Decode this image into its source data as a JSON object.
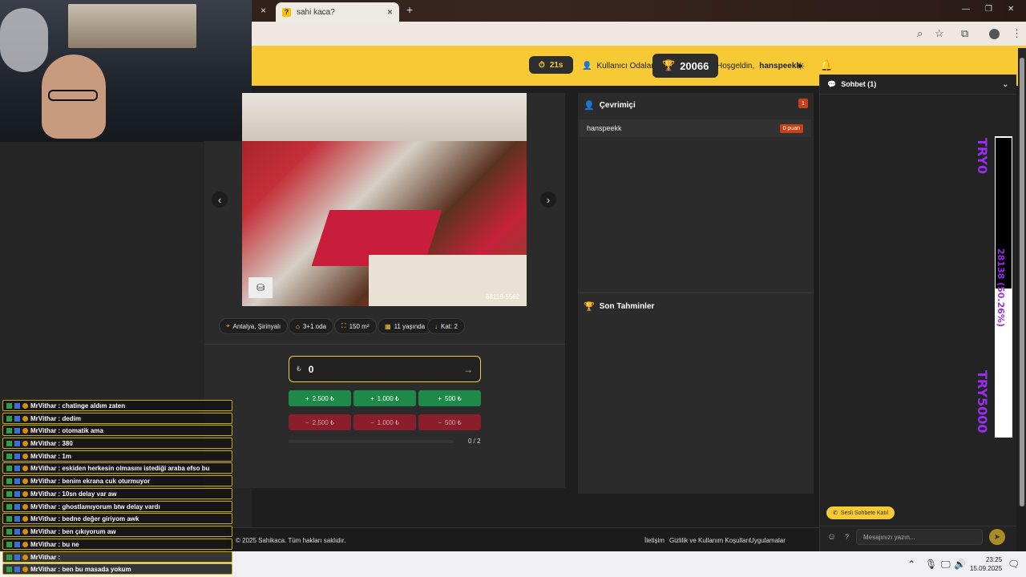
{
  "browser": {
    "tab_title": "sahi kaca?",
    "tab_favicon": "?",
    "tab_close": "×",
    "new_tab": "+",
    "prev_tab_close": "×",
    "window_min": "—",
    "window_max": "❐",
    "window_close": "✕"
  },
  "header": {
    "timer": "21s",
    "rooms_label": "Kullanıcı Odaları",
    "score": "20066",
    "welcome_prefix": "Hoşgeldin,",
    "username": "hanspeekk"
  },
  "game": {
    "photo_code": "68118-5562",
    "tags": [
      {
        "icon": "location-icon",
        "label": "Antalya, Şirinyalı"
      },
      {
        "icon": "home-icon",
        "label": "3+1 oda"
      },
      {
        "icon": "area-icon",
        "label": "150 m²"
      },
      {
        "icon": "building-icon",
        "label": "11 yaşında"
      },
      {
        "icon": "floor-icon",
        "label": "Kat: 2"
      }
    ],
    "guess_currency": "₺",
    "guess_value": "0",
    "plus_buttons": [
      "2.500 ₺",
      "1.000 ₺",
      "500 ₺"
    ],
    "minus_buttons": [
      "2.500 ₺",
      "1.000 ₺",
      "500 ₺"
    ],
    "progress_text": "0 / 2",
    "progress_fraction": 0
  },
  "online": {
    "title": "Çevrimiçi",
    "count": "1",
    "users": [
      {
        "name": "hanspeekk",
        "points": "0 puan"
      }
    ]
  },
  "recent": {
    "title": "Son Tahminler"
  },
  "chat": {
    "title": "Sohbet (1)",
    "voice_button": "Sesli Sohbete Katıl",
    "input_placeholder": "Mesajınızı yazın...",
    "help": "?"
  },
  "footer": {
    "copyright": "© 2025 Sahikaca. Tüm hakları saklıdır.",
    "links": [
      "İletişim",
      "Gizlilik ve Kullanım Koşulları",
      "Uygulamalar"
    ]
  },
  "overlay": {
    "top_text": "TRY0",
    "mid_text": "28138 (50.26%)",
    "bottom_text": "TRY5000"
  },
  "stream_chat": [
    "MrVithar : chatinge aldım zaten",
    "MrVithar : dedim",
    "MrVithar : otomatik ama",
    "MrVithar : 380",
    "MrVithar : 1m",
    "MrVithar : eskiden herkesin olmasını istediği araba efso bu",
    "MrVithar : benim ekrana cuk oturmuyor",
    "MrVithar : 10sn delay var aw",
    "MrVithar : ghostlamıyorum btw delay vardı",
    "MrVithar : bedne değer giriyom awk",
    "MrVithar : ben çıkıyorum aw",
    "MrVithar : bu ne",
    "MrVithar :",
    "MrVithar : ben bu masada yokum"
  ],
  "taskbar": {
    "time": "23:25",
    "date": "15.09.2025"
  },
  "colors": {
    "accent": "#f7c934",
    "plus": "#1d8a4a",
    "minus": "#8a1e2a",
    "badge": "#c8401a",
    "overlay_text": "#9b2cf2"
  }
}
